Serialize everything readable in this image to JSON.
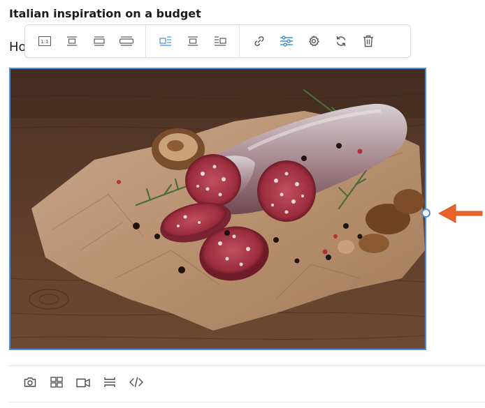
{
  "document": {
    "title": "Italian inspiration on a budget",
    "body_text_visible": "Ho"
  },
  "image_toolbar": {
    "groups": [
      {
        "group": "size",
        "buttons": [
          {
            "id": "original-size",
            "icon": "ratio-1-1-icon",
            "label": "1:1"
          },
          {
            "id": "small-width",
            "icon": "width-small-icon"
          },
          {
            "id": "medium-width",
            "icon": "width-medium-icon"
          },
          {
            "id": "full-width",
            "icon": "width-full-icon"
          }
        ]
      },
      {
        "group": "alignment",
        "buttons": [
          {
            "id": "align-left",
            "icon": "align-left-wrap-icon",
            "active": true
          },
          {
            "id": "align-center",
            "icon": "align-center-icon"
          },
          {
            "id": "align-right",
            "icon": "align-right-wrap-icon"
          }
        ]
      },
      {
        "group": "actions",
        "buttons": [
          {
            "id": "link",
            "icon": "link-icon"
          },
          {
            "id": "adjust",
            "icon": "sliders-icon",
            "active": true
          },
          {
            "id": "settings",
            "icon": "gear-icon"
          },
          {
            "id": "replace",
            "icon": "refresh-icon"
          },
          {
            "id": "delete",
            "icon": "trash-icon"
          }
        ]
      }
    ]
  },
  "insert_toolbar": {
    "buttons": [
      {
        "id": "insert-photo",
        "icon": "camera-icon"
      },
      {
        "id": "insert-gallery",
        "icon": "gallery-grid-icon"
      },
      {
        "id": "insert-video",
        "icon": "video-camera-icon"
      },
      {
        "id": "insert-divider",
        "icon": "divider-icon"
      },
      {
        "id": "insert-html",
        "icon": "code-icon"
      }
    ]
  },
  "colors": {
    "accent": "#4a90d9",
    "active_icon": "#3a8fd6",
    "icon": "#5a5a5a",
    "arrow": "#e8622a"
  }
}
